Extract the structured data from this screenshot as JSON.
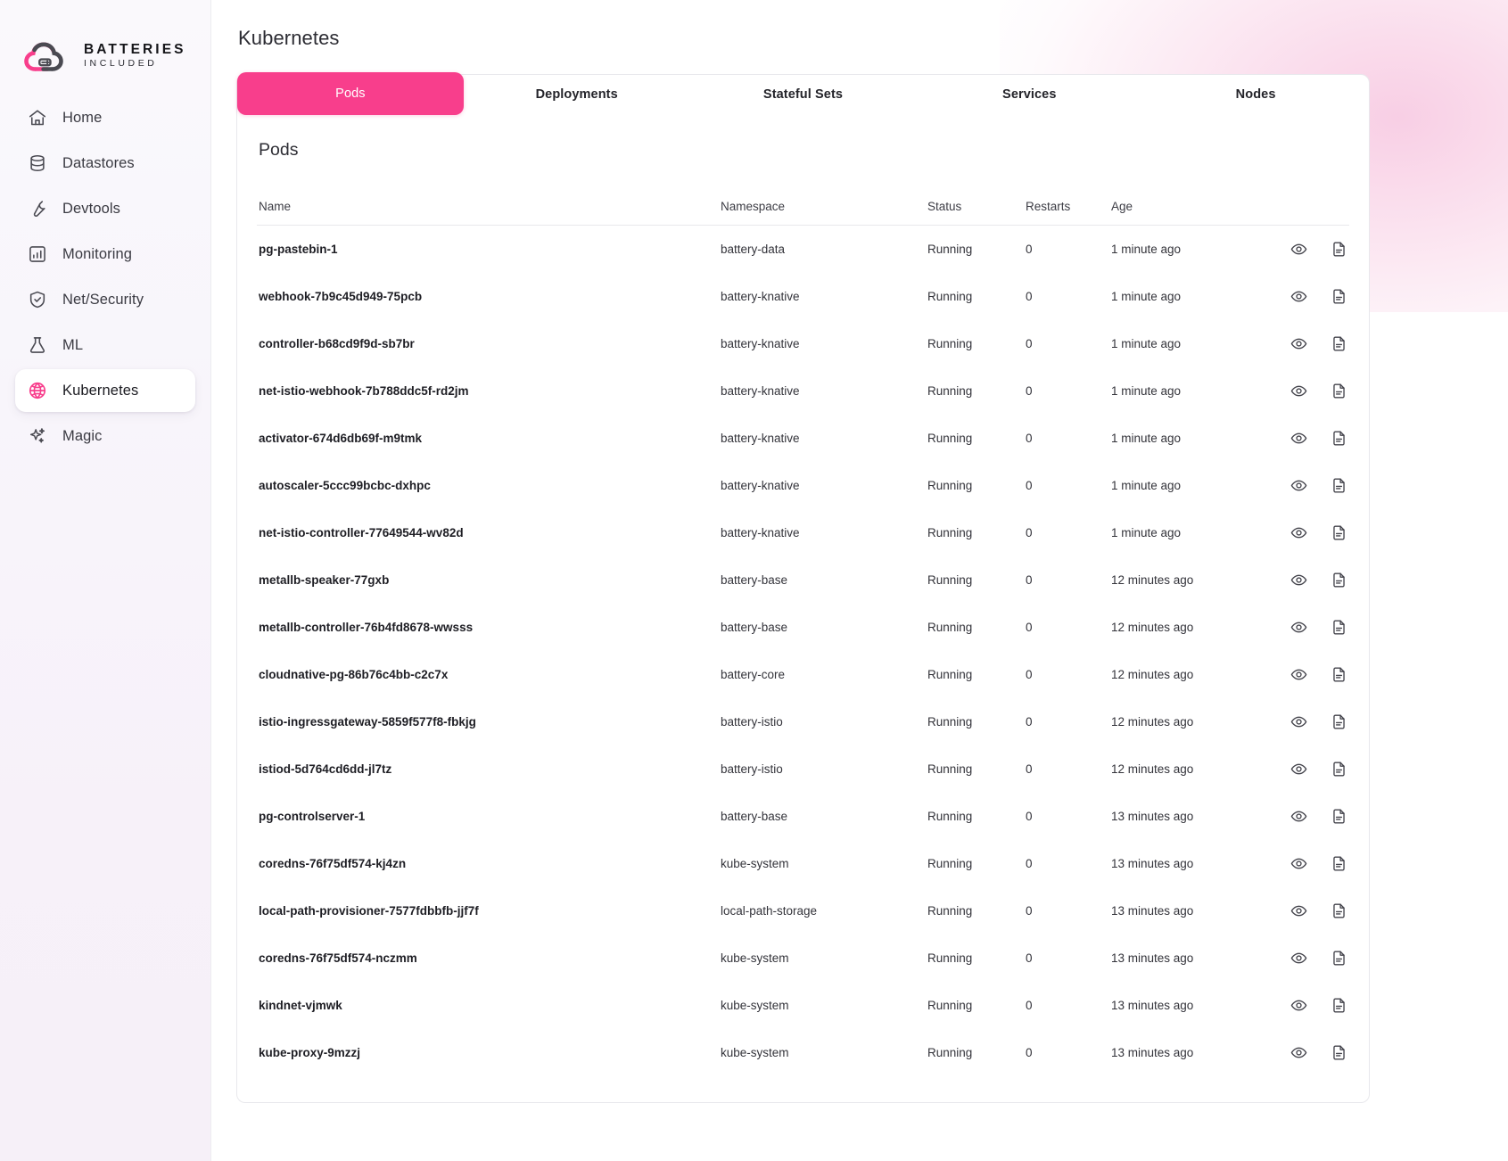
{
  "brand": {
    "title": "BATTERIES",
    "subtitle": "INCLUDED",
    "logo_icon": "cloud-battery-logo",
    "accent_color": "#f83e8c"
  },
  "sidebar": {
    "items": [
      {
        "label": "Home",
        "icon": "home-icon",
        "active": false
      },
      {
        "label": "Datastores",
        "icon": "database-icon",
        "active": false
      },
      {
        "label": "Devtools",
        "icon": "wrench-icon",
        "active": false
      },
      {
        "label": "Monitoring",
        "icon": "chart-bar-icon",
        "active": false
      },
      {
        "label": "Net/Security",
        "icon": "shield-check-icon",
        "active": false
      },
      {
        "label": "ML",
        "icon": "flask-icon",
        "active": false
      },
      {
        "label": "Kubernetes",
        "icon": "globe-icon",
        "active": true
      },
      {
        "label": "Magic",
        "icon": "sparkles-icon",
        "active": false
      }
    ]
  },
  "page": {
    "title": "Kubernetes"
  },
  "tabs": [
    {
      "label": "Pods",
      "active": true
    },
    {
      "label": "Deployments",
      "active": false
    },
    {
      "label": "Stateful Sets",
      "active": false
    },
    {
      "label": "Services",
      "active": false
    },
    {
      "label": "Nodes",
      "active": false
    }
  ],
  "panel": {
    "title": "Pods"
  },
  "table": {
    "columns": [
      "Name",
      "Namespace",
      "Status",
      "Restarts",
      "Age",
      ""
    ],
    "row_actions": [
      {
        "icon": "eye-icon",
        "name": "view-pod-button"
      },
      {
        "icon": "file-text-icon",
        "name": "pod-logs-button"
      }
    ],
    "rows": [
      {
        "name": "pg-pastebin-1",
        "namespace": "battery-data",
        "status": "Running",
        "restarts": "0",
        "age": "1 minute ago"
      },
      {
        "name": "webhook-7b9c45d949-75pcb",
        "namespace": "battery-knative",
        "status": "Running",
        "restarts": "0",
        "age": "1 minute ago"
      },
      {
        "name": "controller-b68cd9f9d-sb7br",
        "namespace": "battery-knative",
        "status": "Running",
        "restarts": "0",
        "age": "1 minute ago"
      },
      {
        "name": "net-istio-webhook-7b788ddc5f-rd2jm",
        "namespace": "battery-knative",
        "status": "Running",
        "restarts": "0",
        "age": "1 minute ago"
      },
      {
        "name": "activator-674d6db69f-m9tmk",
        "namespace": "battery-knative",
        "status": "Running",
        "restarts": "0",
        "age": "1 minute ago"
      },
      {
        "name": "autoscaler-5ccc99bcbc-dxhpc",
        "namespace": "battery-knative",
        "status": "Running",
        "restarts": "0",
        "age": "1 minute ago"
      },
      {
        "name": "net-istio-controller-77649544-wv82d",
        "namespace": "battery-knative",
        "status": "Running",
        "restarts": "0",
        "age": "1 minute ago"
      },
      {
        "name": "metallb-speaker-77gxb",
        "namespace": "battery-base",
        "status": "Running",
        "restarts": "0",
        "age": "12 minutes ago"
      },
      {
        "name": "metallb-controller-76b4fd8678-wwsss",
        "namespace": "battery-base",
        "status": "Running",
        "restarts": "0",
        "age": "12 minutes ago"
      },
      {
        "name": "cloudnative-pg-86b76c4bb-c2c7x",
        "namespace": "battery-core",
        "status": "Running",
        "restarts": "0",
        "age": "12 minutes ago"
      },
      {
        "name": "istio-ingressgateway-5859f577f8-fbkjg",
        "namespace": "battery-istio",
        "status": "Running",
        "restarts": "0",
        "age": "12 minutes ago"
      },
      {
        "name": "istiod-5d764cd6dd-jl7tz",
        "namespace": "battery-istio",
        "status": "Running",
        "restarts": "0",
        "age": "12 minutes ago"
      },
      {
        "name": "pg-controlserver-1",
        "namespace": "battery-base",
        "status": "Running",
        "restarts": "0",
        "age": "13 minutes ago"
      },
      {
        "name": "coredns-76f75df574-kj4zn",
        "namespace": "kube-system",
        "status": "Running",
        "restarts": "0",
        "age": "13 minutes ago"
      },
      {
        "name": "local-path-provisioner-7577fdbbfb-jjf7f",
        "namespace": "local-path-storage",
        "status": "Running",
        "restarts": "0",
        "age": "13 minutes ago"
      },
      {
        "name": "coredns-76f75df574-nczmm",
        "namespace": "kube-system",
        "status": "Running",
        "restarts": "0",
        "age": "13 minutes ago"
      },
      {
        "name": "kindnet-vjmwk",
        "namespace": "kube-system",
        "status": "Running",
        "restarts": "0",
        "age": "13 minutes ago"
      },
      {
        "name": "kube-proxy-9mzzj",
        "namespace": "kube-system",
        "status": "Running",
        "restarts": "0",
        "age": "13 minutes ago"
      }
    ]
  }
}
